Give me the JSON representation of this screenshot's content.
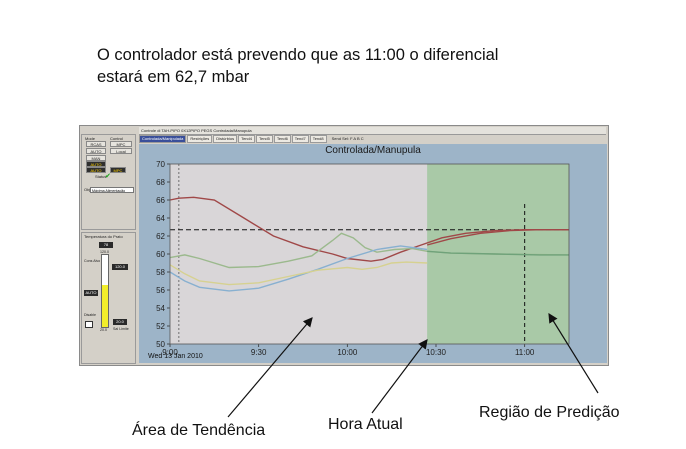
{
  "heading": {
    "line1": "O controlador está prevendo que as 11:00 o diferencial",
    "line2": "estará em 62,7 mbar"
  },
  "window": {
    "title": "Controle di TAH-PIPO 0X12PIPO PEGS Controlada/Manupula",
    "tabs": [
      {
        "label": "Controlada/Manipulada",
        "active": true
      },
      {
        "label": "Restrições",
        "active": false
      },
      {
        "label": "Distúrbios",
        "active": false
      },
      {
        "label": "Tend4",
        "active": false
      },
      {
        "label": "Tend5",
        "active": false
      },
      {
        "label": "Tend6",
        "active": false
      },
      {
        "label": "Tend7",
        "active": false
      },
      {
        "label": "Tend8",
        "active": false
      }
    ],
    "send_select": "Send Sel:  F  A  B  C"
  },
  "left_panel": {
    "mode_label": "Mode",
    "control_label": "Control",
    "buttons": [
      "RCAS",
      "AUTO",
      "MAN",
      "AUTO",
      "AUTO"
    ],
    "control_buttons": [
      "MPC",
      "Local",
      "MPC"
    ],
    "status_label": "Status",
    "status_icon": "check-icon",
    "obj_label": "Obj",
    "obj_value": "Máxima Alimentação"
  },
  "faceplate": {
    "title": "Temperatura do Prato",
    "pv": "78",
    "top_scale": "120.0",
    "cons_label": "Cons Alvo",
    "cons_value": "120.0",
    "mode_value": "AUTO",
    "disable_label": "Disable",
    "bottom_scale": "20.0",
    "bottom_value": "20.0",
    "bottom_label": "Sai Limite",
    "fill_fraction": 0.58,
    "fill_color": "#f2ee2a"
  },
  "chart_data": {
    "type": "line",
    "title": "Controlada/Manupula",
    "x_ticks": [
      "9:00",
      "9:30",
      "10:00",
      "10:30",
      "11:00"
    ],
    "y_ticks": [
      50,
      52,
      54,
      56,
      58,
      60,
      62,
      64,
      66,
      68,
      70
    ],
    "ylim": [
      50,
      70
    ],
    "xlim_minutes": [
      0,
      115
    ],
    "date": "Wed 13 Jan 2010",
    "setpoint": 62.7,
    "current_time_minutes": 87,
    "prediction_region_start_minutes": 87,
    "marker_time_minutes": 3,
    "future_marker_minutes": 120,
    "colors": {
      "plot_bg": "#d9d6d8",
      "frame_bg": "#9db4c8",
      "prediction_bg": "#a9c9a7"
    },
    "series": [
      {
        "color": "#a04848",
        "x": [
          0,
          3,
          8,
          15,
          25,
          35,
          45,
          55,
          60,
          68,
          72,
          78,
          85,
          92,
          100,
          110,
          120,
          135
        ],
        "y": [
          66,
          66.2,
          66.3,
          66,
          64,
          62,
          60.8,
          60,
          59.5,
          59.2,
          59.4,
          60.2,
          61,
          61.8,
          62.3,
          62.6,
          62.7,
          62.7
        ]
      },
      {
        "color": "#9bb98d",
        "x": [
          0,
          5,
          10,
          20,
          30,
          40,
          48,
          55,
          58,
          62,
          66,
          70,
          76,
          82,
          87,
          95,
          110,
          135
        ],
        "y": [
          59.6,
          59.9,
          59.5,
          58.5,
          58.6,
          59.2,
          59.8,
          61.5,
          62.3,
          61.8,
          60.7,
          60.2,
          60.5,
          60.6,
          60.3,
          60.1,
          60,
          59.9
        ]
      },
      {
        "color": "#88b0d0",
        "x": [
          0,
          5,
          10,
          20,
          30,
          40,
          50,
          60,
          70,
          78,
          87
        ],
        "y": [
          58,
          57,
          56.3,
          55.9,
          56.2,
          57.2,
          58.3,
          59.5,
          60.5,
          60.9,
          60.5
        ]
      },
      {
        "color": "#d6d190",
        "x": [
          0,
          5,
          10,
          20,
          30,
          40,
          50,
          60,
          65,
          70,
          75,
          80,
          87
        ],
        "y": [
          58.8,
          57.8,
          57,
          56.6,
          56.8,
          57.5,
          58.2,
          58.5,
          58.3,
          58.5,
          59,
          59.1,
          59
        ]
      },
      {
        "color": "#a04848",
        "x": [
          87,
          95,
          105,
          115,
          125,
          135
        ],
        "y": [
          61,
          61.7,
          62.3,
          62.6,
          62.7,
          62.7
        ]
      },
      {
        "color": "#6fa27a",
        "x": [
          87,
          95,
          110,
          125,
          135
        ],
        "y": [
          60.3,
          60.1,
          60,
          59.9,
          59.9
        ]
      }
    ]
  },
  "annotations": {
    "trend_area": "Área de Tendência",
    "current_time": "Hora Atual",
    "prediction_region": "Região de Predição"
  }
}
